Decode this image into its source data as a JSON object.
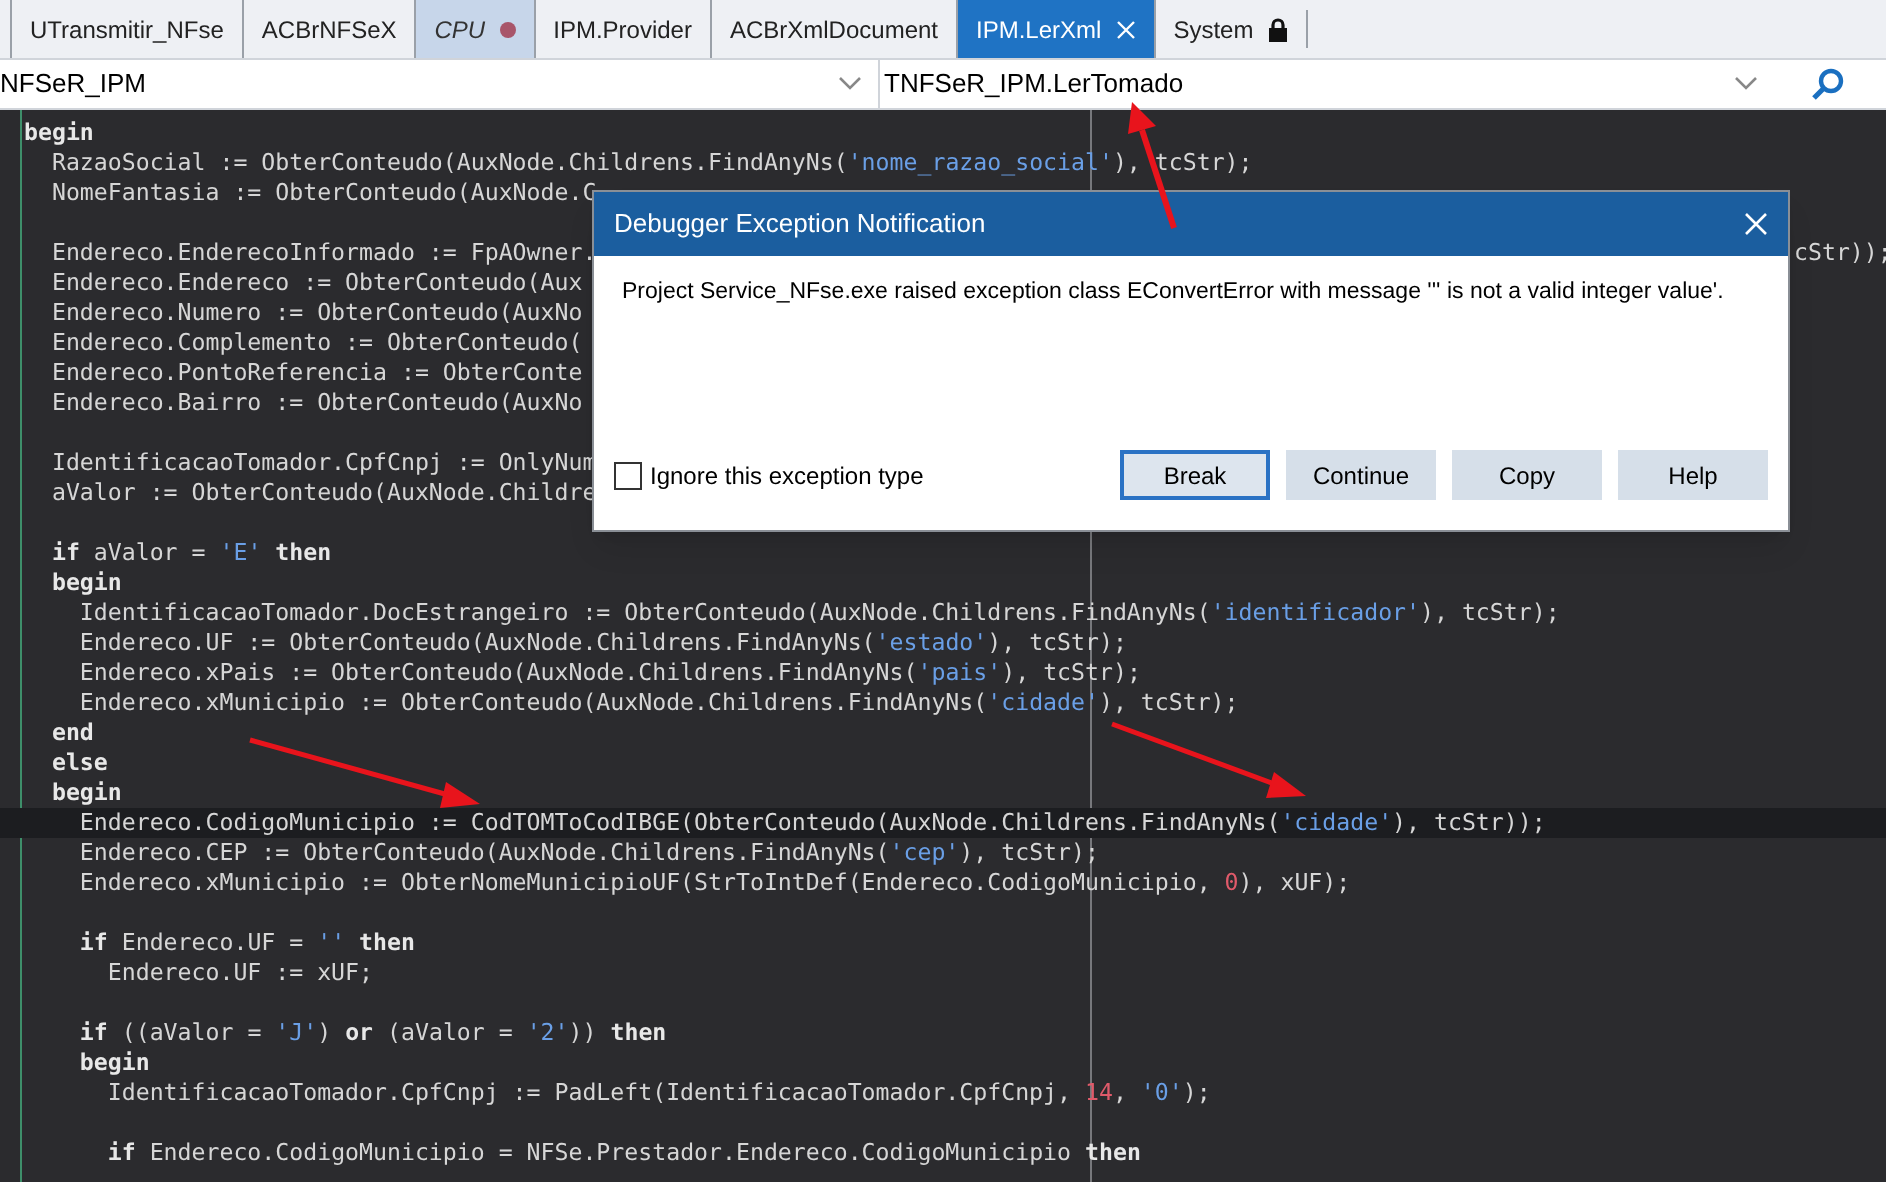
{
  "tabs": [
    {
      "label": "UTransmitir_NFse",
      "selected": false,
      "highlighted": false,
      "modified": false,
      "locked": false
    },
    {
      "label": "ACBrNFSeX",
      "selected": false,
      "highlighted": false,
      "modified": false,
      "locked": false
    },
    {
      "label": "CPU",
      "selected": false,
      "highlighted": true,
      "modified": true,
      "locked": false
    },
    {
      "label": "IPM.Provider",
      "selected": false,
      "highlighted": false,
      "modified": false,
      "locked": false
    },
    {
      "label": "ACBrXmlDocument",
      "selected": false,
      "highlighted": false,
      "modified": false,
      "locked": false
    },
    {
      "label": "IPM.LerXml",
      "selected": true,
      "highlighted": false,
      "modified": false,
      "locked": false
    },
    {
      "label": "System",
      "selected": false,
      "highlighted": false,
      "modified": false,
      "locked": true
    }
  ],
  "navigation": {
    "class_selector": "NFSeR_IPM",
    "method_selector": "TNFSeR_IPM.LerTomado"
  },
  "code_lines": [
    {
      "kind": "code",
      "segments": [
        {
          "kind": "keyword",
          "text": "begin"
        }
      ]
    },
    {
      "kind": "code",
      "segments": [
        {
          "kind": "plain",
          "text": "  RazaoSocial := ObterConteudo(AuxNode.Childrens.FindAnyNs("
        },
        {
          "kind": "string",
          "text": "'nome_razao_social'"
        },
        {
          "kind": "plain",
          "text": "), tcStr);"
        }
      ]
    },
    {
      "kind": "code",
      "segments": [
        {
          "kind": "plain",
          "text": "  NomeFantasia := ObterConteudo(AuxNode.C"
        }
      ]
    },
    {
      "kind": "blank"
    },
    {
      "kind": "code",
      "segments": [
        {
          "kind": "plain",
          "text": "  Endereco.EnderecoInformado := FpAOwner."
        }
      ],
      "right_segments": [
        {
          "kind": "plain",
          "text": "cStr));"
        }
      ]
    },
    {
      "kind": "code",
      "segments": [
        {
          "kind": "plain",
          "text": "  Endereco.Endereco := ObterConteudo(Aux"
        }
      ]
    },
    {
      "kind": "code",
      "segments": [
        {
          "kind": "plain",
          "text": "  Endereco.Numero := ObterConteudo(AuxNo"
        }
      ]
    },
    {
      "kind": "code",
      "segments": [
        {
          "kind": "plain",
          "text": "  Endereco.Complemento := ObterConteudo("
        }
      ]
    },
    {
      "kind": "code",
      "segments": [
        {
          "kind": "plain",
          "text": "  Endereco.PontoReferencia := ObterConte"
        }
      ]
    },
    {
      "kind": "code",
      "segments": [
        {
          "kind": "plain",
          "text": "  Endereco.Bairro := ObterConteudo(AuxNo"
        }
      ]
    },
    {
      "kind": "blank"
    },
    {
      "kind": "code",
      "segments": [
        {
          "kind": "plain",
          "text": "  IdentificacaoTomador.CpfCnpj := OnlyNum"
        }
      ]
    },
    {
      "kind": "code",
      "segments": [
        {
          "kind": "plain",
          "text": "  aValor := ObterConteudo(AuxNode.Childre"
        }
      ]
    },
    {
      "kind": "blank"
    },
    {
      "kind": "code",
      "segments": [
        {
          "kind": "keyword",
          "text": "  if"
        },
        {
          "kind": "plain",
          "text": " aValor = "
        },
        {
          "kind": "string",
          "text": "'E'"
        },
        {
          "kind": "keyword",
          "text": " then"
        }
      ]
    },
    {
      "kind": "code",
      "segments": [
        {
          "kind": "keyword",
          "text": "  begin"
        }
      ]
    },
    {
      "kind": "code",
      "segments": [
        {
          "kind": "plain",
          "text": "    IdentificacaoTomador.DocEstrangeiro := ObterConteudo(AuxNode.Childrens.FindAnyNs("
        },
        {
          "kind": "string",
          "text": "'identificador'"
        },
        {
          "kind": "plain",
          "text": "), tcStr);"
        }
      ]
    },
    {
      "kind": "code",
      "segments": [
        {
          "kind": "plain",
          "text": "    Endereco.UF := ObterConteudo(AuxNode.Childrens.FindAnyNs("
        },
        {
          "kind": "string",
          "text": "'estado'"
        },
        {
          "kind": "plain",
          "text": "), tcStr);"
        }
      ]
    },
    {
      "kind": "code",
      "segments": [
        {
          "kind": "plain",
          "text": "    Endereco.xPais := ObterConteudo(AuxNode.Childrens.FindAnyNs("
        },
        {
          "kind": "string",
          "text": "'pais'"
        },
        {
          "kind": "plain",
          "text": "), tcStr);"
        }
      ]
    },
    {
      "kind": "code",
      "segments": [
        {
          "kind": "plain",
          "text": "    Endereco.xMunicipio := ObterConteudo(AuxNode.Childrens.FindAnyNs("
        },
        {
          "kind": "string",
          "text": "'cidade'"
        },
        {
          "kind": "plain",
          "text": "), tcStr);"
        }
      ]
    },
    {
      "kind": "code",
      "segments": [
        {
          "kind": "keyword",
          "text": "  end"
        }
      ]
    },
    {
      "kind": "code",
      "segments": [
        {
          "kind": "keyword",
          "text": "  else"
        }
      ]
    },
    {
      "kind": "code",
      "segments": [
        {
          "kind": "keyword",
          "text": "  begin"
        }
      ]
    },
    {
      "kind": "code",
      "current": true,
      "segments": [
        {
          "kind": "plain",
          "text": "    Endereco.CodigoMunicipio := CodTOMToCodIBGE(ObterConteudo(AuxNode.Childrens.FindAnyNs("
        },
        {
          "kind": "string",
          "text": "'cidade'"
        },
        {
          "kind": "plain",
          "text": "), tcStr));"
        }
      ]
    },
    {
      "kind": "code",
      "segments": [
        {
          "kind": "plain",
          "text": "    Endereco.CEP := ObterConteudo(AuxNode.Childrens.FindAnyNs("
        },
        {
          "kind": "string",
          "text": "'cep'"
        },
        {
          "kind": "plain",
          "text": "), tcStr);"
        }
      ]
    },
    {
      "kind": "code",
      "segments": [
        {
          "kind": "plain",
          "text": "    Endereco.xMunicipio := ObterNomeMunicipioUF(StrToIntDef(Endereco.CodigoMunicipio, "
        },
        {
          "kind": "number",
          "text": "0"
        },
        {
          "kind": "plain",
          "text": "), xUF);"
        }
      ]
    },
    {
      "kind": "blank"
    },
    {
      "kind": "code",
      "segments": [
        {
          "kind": "keyword",
          "text": "    if"
        },
        {
          "kind": "plain",
          "text": " Endereco.UF = "
        },
        {
          "kind": "string",
          "text": "''"
        },
        {
          "kind": "keyword",
          "text": " then"
        }
      ]
    },
    {
      "kind": "code",
      "segments": [
        {
          "kind": "plain",
          "text": "      Endereco.UF := xUF;"
        }
      ]
    },
    {
      "kind": "blank"
    },
    {
      "kind": "code",
      "segments": [
        {
          "kind": "keyword",
          "text": "    if"
        },
        {
          "kind": "plain",
          "text": " ((aValor = "
        },
        {
          "kind": "string",
          "text": "'J'"
        },
        {
          "kind": "plain",
          "text": ") "
        },
        {
          "kind": "keyword",
          "text": "or"
        },
        {
          "kind": "plain",
          "text": " (aValor = "
        },
        {
          "kind": "string",
          "text": "'2'"
        },
        {
          "kind": "plain",
          "text": ")) "
        },
        {
          "kind": "keyword",
          "text": "then"
        }
      ]
    },
    {
      "kind": "code",
      "segments": [
        {
          "kind": "keyword",
          "text": "    begin"
        }
      ]
    },
    {
      "kind": "code",
      "segments": [
        {
          "kind": "plain",
          "text": "      IdentificacaoTomador.CpfCnpj := PadLeft(IdentificacaoTomador.CpfCnpj, "
        },
        {
          "kind": "number",
          "text": "14"
        },
        {
          "kind": "plain",
          "text": ", "
        },
        {
          "kind": "string",
          "text": "'0'"
        },
        {
          "kind": "plain",
          "text": ");"
        }
      ]
    },
    {
      "kind": "blank"
    },
    {
      "kind": "code",
      "segments": [
        {
          "kind": "keyword",
          "text": "      if"
        },
        {
          "kind": "plain",
          "text": " Endereco.CodigoMunicipio = NFSe.Prestador.Endereco.CodigoMunicipio "
        },
        {
          "kind": "keyword",
          "text": "then"
        }
      ]
    }
  ],
  "dialog": {
    "title": "Debugger Exception Notification",
    "message": "Project Service_NFse.exe raised exception class EConvertError with message ''' is not a valid integer value'.",
    "checkbox": {
      "label": "Ignore this exception type",
      "checked": false
    },
    "buttons": [
      {
        "label": "Break",
        "default": true
      },
      {
        "label": "Continue",
        "default": false
      },
      {
        "label": "Copy",
        "default": false
      },
      {
        "label": "Help",
        "default": false
      }
    ]
  }
}
